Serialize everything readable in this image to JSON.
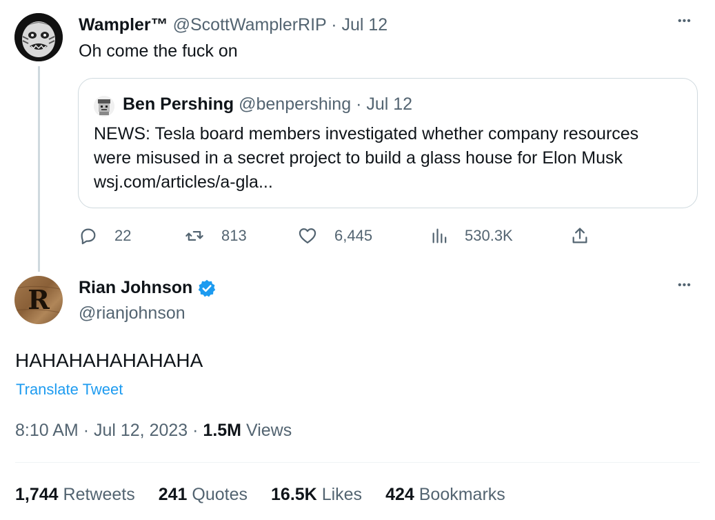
{
  "quoted_tweet": {
    "author_name": "Wampler™",
    "handle": "@ScottWamplerRIP",
    "separator": "·",
    "date": "Jul 12",
    "text": "Oh come the fuck on",
    "more": "•••",
    "embedded": {
      "author_name": "Ben Pershing",
      "handle": "@benpershing",
      "separator": "·",
      "date": "Jul 12",
      "text_line1": "NEWS: Tesla board members investigated whether company resources",
      "text_line2": "were misused in a secret project to build a glass house for Elon Musk",
      "link_text": "wsj.com/articles/a-gla..."
    },
    "actions": {
      "replies": "22",
      "retweets": "813",
      "likes": "6,445",
      "views": "530.3K"
    }
  },
  "main_tweet": {
    "author_name": "Rian Johnson",
    "handle": "@rianjohnson",
    "avatar_letter": "R",
    "verified": true,
    "more": "•••",
    "text": "HAHAHAHAHAHAHA",
    "translate_label": "Translate Tweet",
    "time": "8:10 AM",
    "separator": "·",
    "date": "Jul 12, 2023",
    "views_count": "1.5M",
    "views_label": "Views",
    "stats": {
      "retweets_count": "1,744",
      "retweets_label": "Retweets",
      "quotes_count": "241",
      "quotes_label": "Quotes",
      "likes_count": "16.5K",
      "likes_label": "Likes",
      "bookmarks_count": "424",
      "bookmarks_label": "Bookmarks"
    }
  },
  "colors": {
    "accent": "#1d9bf0",
    "text": "#0f1419",
    "muted": "#536471",
    "border": "#cfd9de"
  }
}
